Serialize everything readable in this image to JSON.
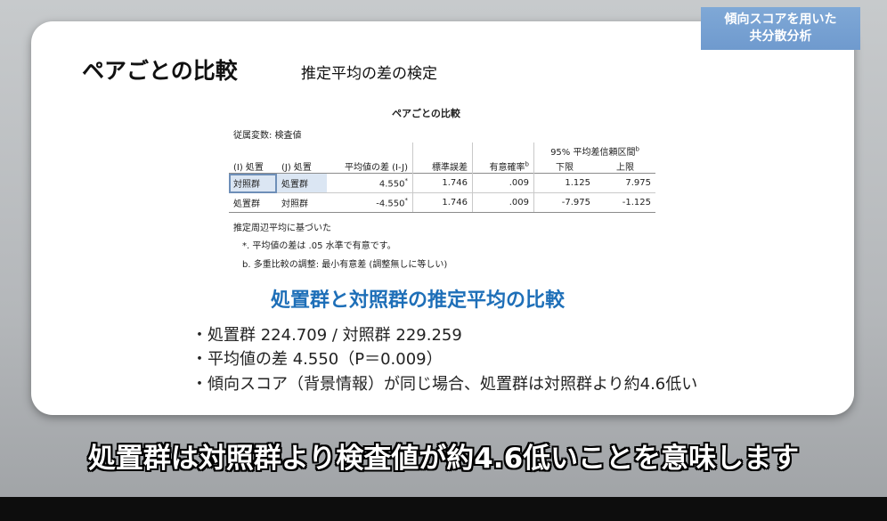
{
  "badge": {
    "line1": "傾向スコアを用いた",
    "line2": "共分散分析"
  },
  "slide": {
    "title": "ペアごとの比較",
    "subtitle": "推定平均の差の検定",
    "table_title": "ペアごとの比較",
    "dependent_variable": "従属変数:  検査値",
    "ci_header": "95% 平均差信頼区間",
    "ci_header_sup": "b",
    "headers": {
      "i": "(I) 処置",
      "j": "(J) 処置",
      "mean_diff": "平均値の差 (I-J)",
      "std_err": "標準誤差",
      "sig": "有意確率",
      "sig_sup": "b",
      "lower": "下限",
      "upper": "上限"
    },
    "rows": [
      {
        "i": "対照群",
        "j": "処置群",
        "mean_diff": "4.550",
        "mark": "*",
        "std_err": "1.746",
        "sig": ".009",
        "lower": "1.125",
        "upper": "7.975"
      },
      {
        "i": "処置群",
        "j": "対照群",
        "mean_diff": "-4.550",
        "mark": "*",
        "std_err": "1.746",
        "sig": ".009",
        "lower": "-7.975",
        "upper": "-1.125"
      }
    ],
    "footnotes": {
      "based_on": "推定周辺平均に基づいた",
      "star": "*. 平均値の差は .05 水準で有意です。",
      "b": "b. 多重比較の調整: 最小有意差 (調整無しに等しい)"
    },
    "comparison_heading": "処置群と対照群の推定平均の比較",
    "bullets": [
      "・処置群 224.709 / 対照群 229.259",
      "・平均値の差 4.550（P＝0.009）",
      "・傾向スコア（背景情報）が同じ場合、処置群は対照群より約4.6低い"
    ]
  },
  "caption": "処置群は対照群より検査値が約4.6低いことを意味します",
  "colors": {
    "accent": "#1e6fb8",
    "badge": "#7fa8d6",
    "selection": "#dbe6f3"
  }
}
